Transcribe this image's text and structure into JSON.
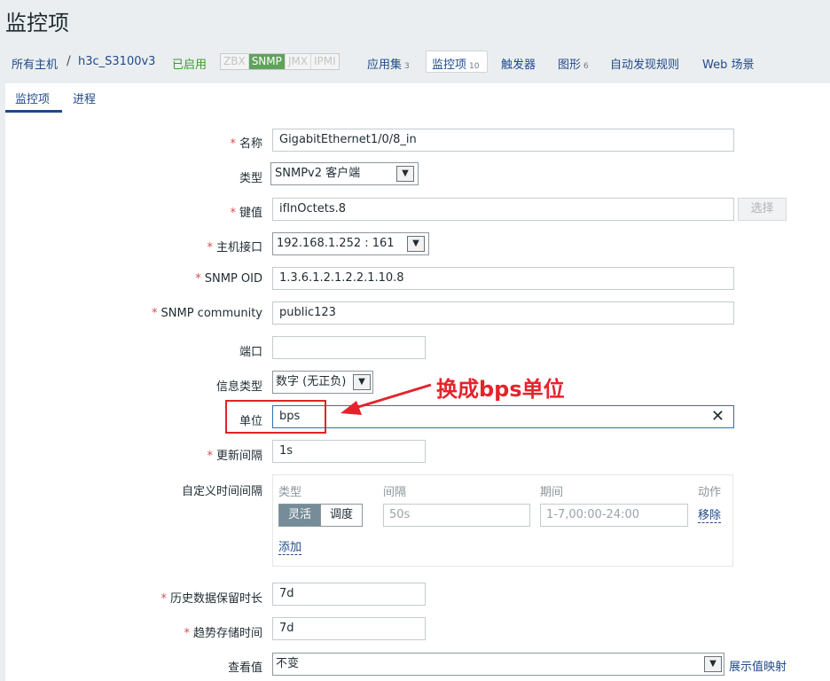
{
  "page": {
    "title": "监控项"
  },
  "breadcrumb": {
    "all_hosts": "所有主机",
    "separator": "/",
    "host": "h3c_S3100v3",
    "status": "已启用",
    "protocols": [
      "ZBX",
      "SNMP",
      "JMX",
      "IPMI"
    ],
    "active_protocol": "SNMP",
    "nav": {
      "applications": "应用集",
      "applications_count": "3",
      "items": "监控项",
      "items_count": "10",
      "triggers": "触发器",
      "graphs": "图形",
      "graphs_count": "6",
      "discovery": "自动发现规则",
      "web": "Web 场景"
    }
  },
  "tabs": {
    "items": "监控项",
    "preprocessing": "进程"
  },
  "form": {
    "name": {
      "label": "名称",
      "value": "GigabitEthernet1/0/8_in"
    },
    "type": {
      "label": "类型",
      "value": "SNMPv2 客户端"
    },
    "key": {
      "label": "键值",
      "value": "ifInOctets.8",
      "select_button": "选择"
    },
    "interface": {
      "label": "主机接口",
      "value": "192.168.1.252 : 161"
    },
    "oid": {
      "label": "SNMP OID",
      "value": "1.3.6.1.2.1.2.2.1.10.8"
    },
    "community": {
      "label": "SNMP community",
      "value": "public123"
    },
    "port": {
      "label": "端口",
      "value": ""
    },
    "info_type": {
      "label": "信息类型",
      "value": "数字 (无正负)"
    },
    "units": {
      "label": "单位",
      "value": "bps"
    },
    "update_interval": {
      "label": "更新间隔",
      "value": "1s"
    },
    "custom_intervals": {
      "label": "自定义时间间隔",
      "headers": {
        "type": "类型",
        "interval": "间隔",
        "period": "期间",
        "action": "动作"
      },
      "flexible": "灵活",
      "scheduling": "调度",
      "interval_placeholder": "50s",
      "period_placeholder": "1-7,00:00-24:00",
      "remove": "移除",
      "add": "添加"
    },
    "history": {
      "label": "历史数据保留时长",
      "value": "7d"
    },
    "trends": {
      "label": "趋势存储时间",
      "value": "7d"
    },
    "valuemap": {
      "label": "查看值",
      "value": "不变",
      "link": "展示值映射"
    }
  },
  "annotation": {
    "text": "换成bps单位",
    "color": "#e5232b"
  }
}
